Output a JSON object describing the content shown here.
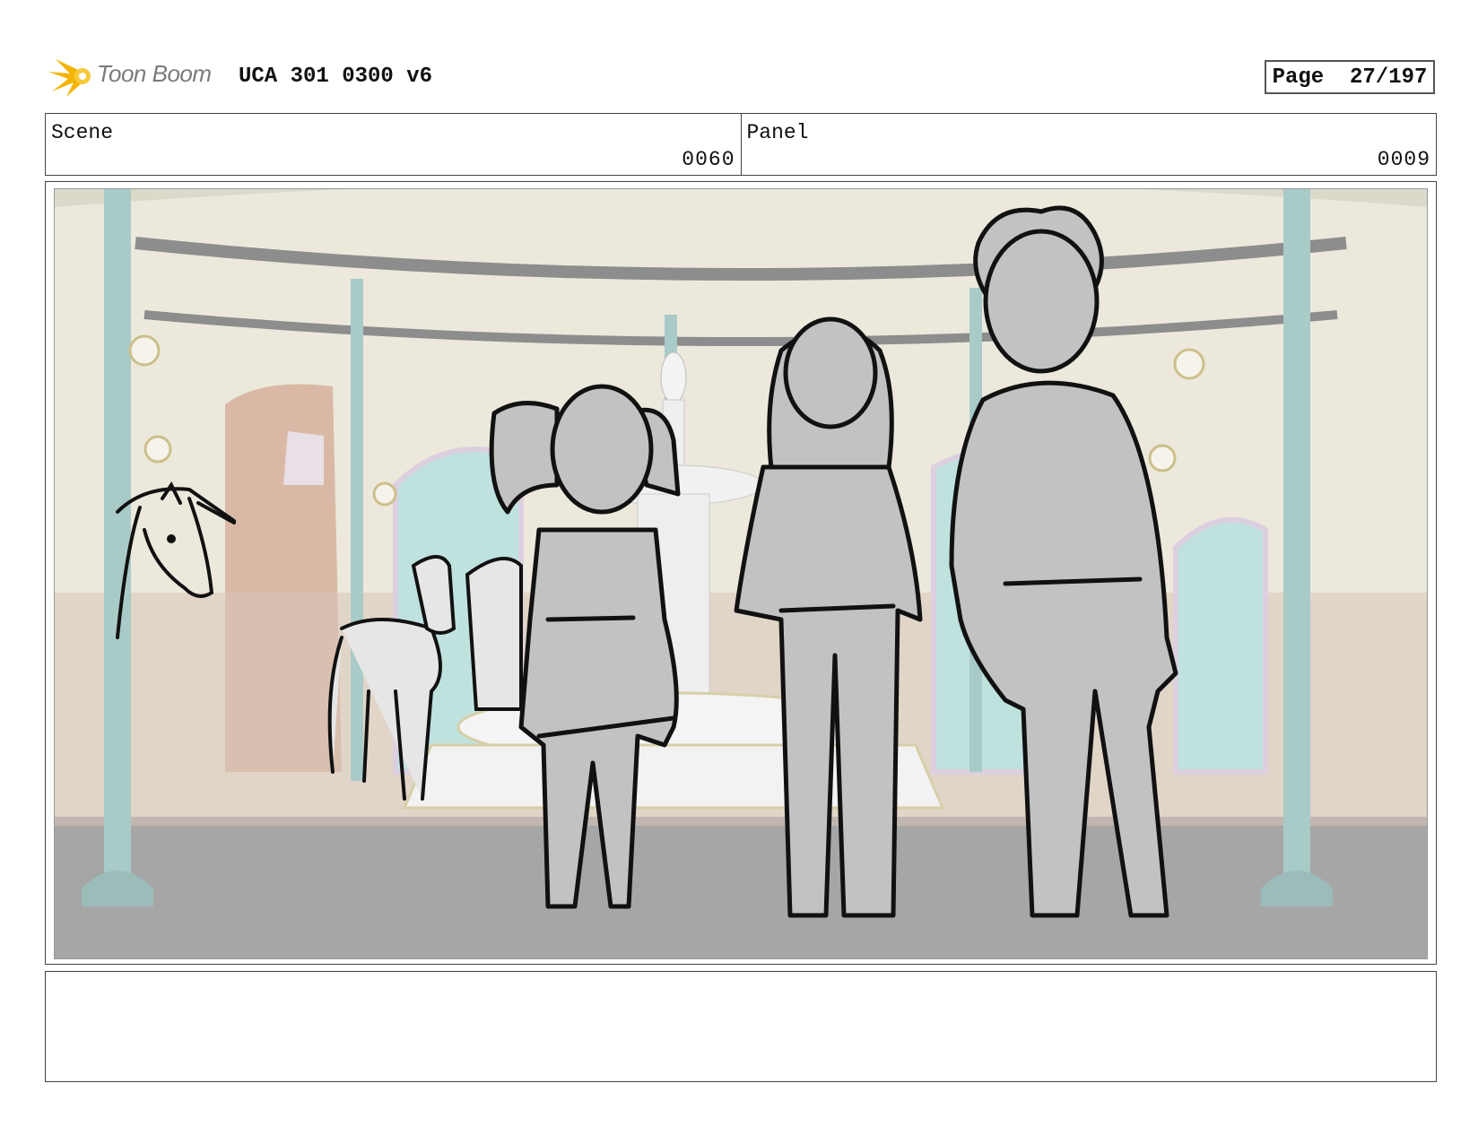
{
  "header": {
    "logo_text": "Toon Boom",
    "title": "UCA 301 0300 v6",
    "page": "Page  27/197"
  },
  "scene": {
    "label": "Scene",
    "number": "0060"
  },
  "panel": {
    "label": "Panel",
    "number": "0009"
  },
  "notes": {
    "text": ""
  },
  "colors": {
    "logo_star": "#f4b400",
    "pillar": "#a9cbc8",
    "wall": "#ece9dc",
    "door": "#d9b9a5",
    "window": "#bfe2df",
    "floor": "#a6a6a6",
    "figure_fill": "#c2c2c2",
    "outline": "#111111"
  }
}
